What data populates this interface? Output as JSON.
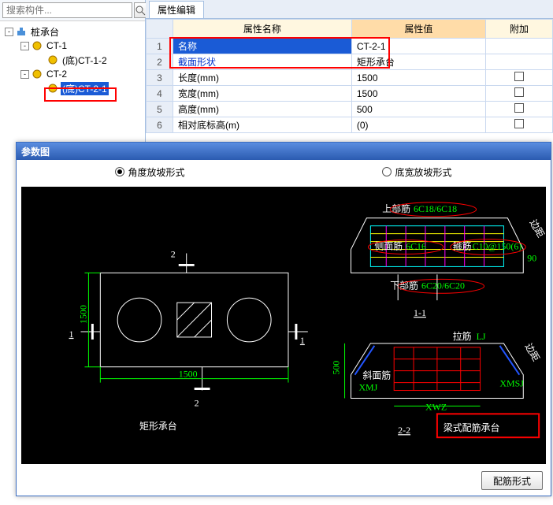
{
  "search": {
    "placeholder": "搜索构件...",
    "go_icon": "search-icon",
    "collapse_icon": "collapse-icon"
  },
  "tree": {
    "root": "桩承台",
    "nodes": [
      {
        "label": "CT-1",
        "children": [
          {
            "label": "(底)CT-1-2"
          }
        ]
      },
      {
        "label": "CT-2",
        "children": [
          {
            "label": "(底)CT-2-1",
            "selected": true
          }
        ]
      }
    ]
  },
  "prop_tab": "属性编辑",
  "prop_headers": {
    "name": "属性名称",
    "value": "属性值",
    "extra": "附加"
  },
  "prop_rows": [
    {
      "n": "1",
      "name": "名称",
      "value": "CT-2-1",
      "chk": false,
      "sel": true
    },
    {
      "n": "2",
      "name": "截面形状",
      "value": "矩形承台",
      "chk": false
    },
    {
      "n": "3",
      "name": "长度(mm)",
      "value": "1500",
      "chk": true
    },
    {
      "n": "4",
      "name": "宽度(mm)",
      "value": "1500",
      "chk": true
    },
    {
      "n": "5",
      "name": "高度(mm)",
      "value": "500",
      "chk": true
    },
    {
      "n": "6",
      "name": "相对底标高(m)",
      "value": "(0)",
      "chk": true
    }
  ],
  "param": {
    "title": "参数图",
    "radio1": "角度放坡形式",
    "radio2": "底宽放坡形式",
    "button": "配筋形式"
  },
  "diagram": {
    "left": {
      "caption": "矩形承台",
      "width_dim": "1500",
      "height_dim": "1500",
      "mark_top": "2",
      "mark_bottom": "2",
      "mark_left_a": "1",
      "mark_left_b": "1"
    },
    "right": {
      "top_label": "上部筋",
      "top_val": "6C18/6C18",
      "side_label": "侧面筋",
      "side_val": "6C16",
      "hoop_label": "箍筋",
      "hoop_val": "C10@150(6)",
      "bot_label": "下部筋",
      "bot_val": "6C20/6C20",
      "angle": "90",
      "sec1": "1-1",
      "sec2": "2-2",
      "xmj": "XMJ",
      "xwz": "XWZ",
      "xmsj": "XMSJ",
      "la_label": "拉筋",
      "la_val": "LJ",
      "bian_label": "边距",
      "h500": "500",
      "callout": "梁式配筋承台",
      "slant_label": "斜面筋"
    }
  }
}
